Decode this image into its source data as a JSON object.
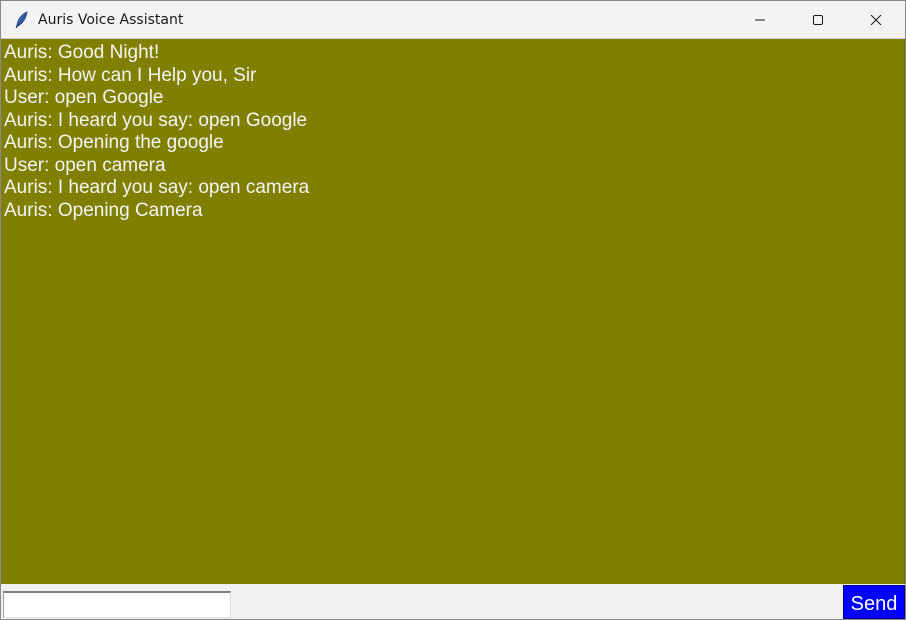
{
  "window": {
    "title": "Auris Voice Assistant",
    "icon": "feather-icon"
  },
  "chat": {
    "background": "#808000",
    "text_color": "#f4f4f4",
    "lines": [
      "Auris: Good Night!",
      "Auris: How can I Help you, Sir",
      "User: open Google",
      "Auris: I heard you say: open Google",
      "Auris: Opening the google",
      "User: open camera",
      "Auris: I heard you say: open camera",
      "Auris: Opening Camera"
    ]
  },
  "input": {
    "value": "",
    "placeholder": ""
  },
  "send_button": {
    "label": "Send",
    "background": "#0000ff"
  }
}
